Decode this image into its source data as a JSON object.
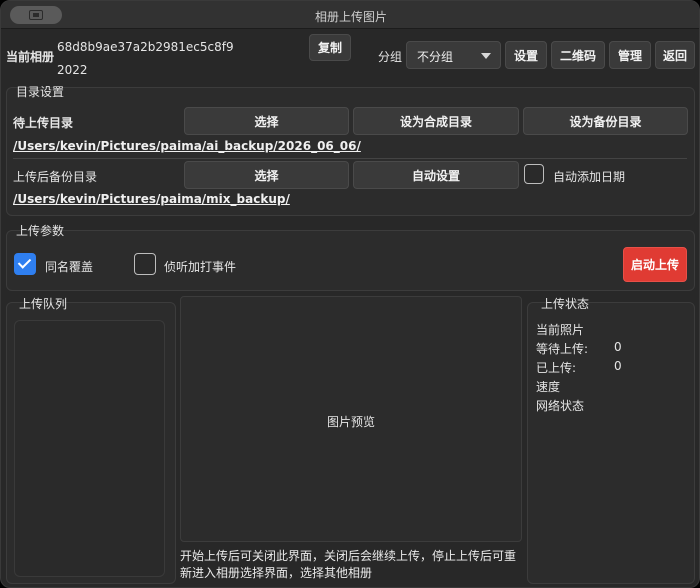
{
  "window": {
    "title": "相册上传图片"
  },
  "header": {
    "current_album_label": "当前相册",
    "album_id": "68d8b9ae37a2b2981ec5c8f9",
    "album_year": "2022",
    "copy_label": "复制",
    "group_label": "分组",
    "group_value": "不分组",
    "settings_label": "设置",
    "qrcode_label": "二维码",
    "manage_label": "管理",
    "back_label": "返回"
  },
  "dir_settings": {
    "title": "目录设置",
    "upload_dir_label": "待上传目录",
    "select_label": "选择",
    "set_composite_label": "设为合成目录",
    "set_backup_label": "设为备份目录",
    "upload_dir_path": "/Users/kevin/Pictures/paima/ai_backup/2026_06_06/",
    "backup_dir_label": "上传后备份目录",
    "select2_label": "选择",
    "auto_set_label": "自动设置",
    "auto_date_label": "自动添加日期",
    "auto_date_checked": false,
    "backup_dir_path": "/Users/kevin/Pictures/paima/mix_backup/"
  },
  "upload_params": {
    "title": "上传参数",
    "overwrite_label": "同名覆盖",
    "overwrite_checked": true,
    "listen_label": "侦听加打事件",
    "listen_checked": false,
    "start_label": "启动上传"
  },
  "queue": {
    "title": "上传队列"
  },
  "preview": {
    "label": "图片预览",
    "note": "开始上传后可关闭此界面，关闭后会继续上传，停止上传后可重新进入相册选择界面，选择其他相册"
  },
  "status": {
    "title": "上传状态",
    "current_photo_label": "当前照片",
    "waiting_label": "等待上传:",
    "waiting_value": "0",
    "uploaded_label": "已上传:",
    "uploaded_value": "0",
    "speed_label": "速度",
    "network_label": "网络状态"
  },
  "colors": {
    "accent": "#2f7ff0",
    "start": "#e03b33"
  }
}
